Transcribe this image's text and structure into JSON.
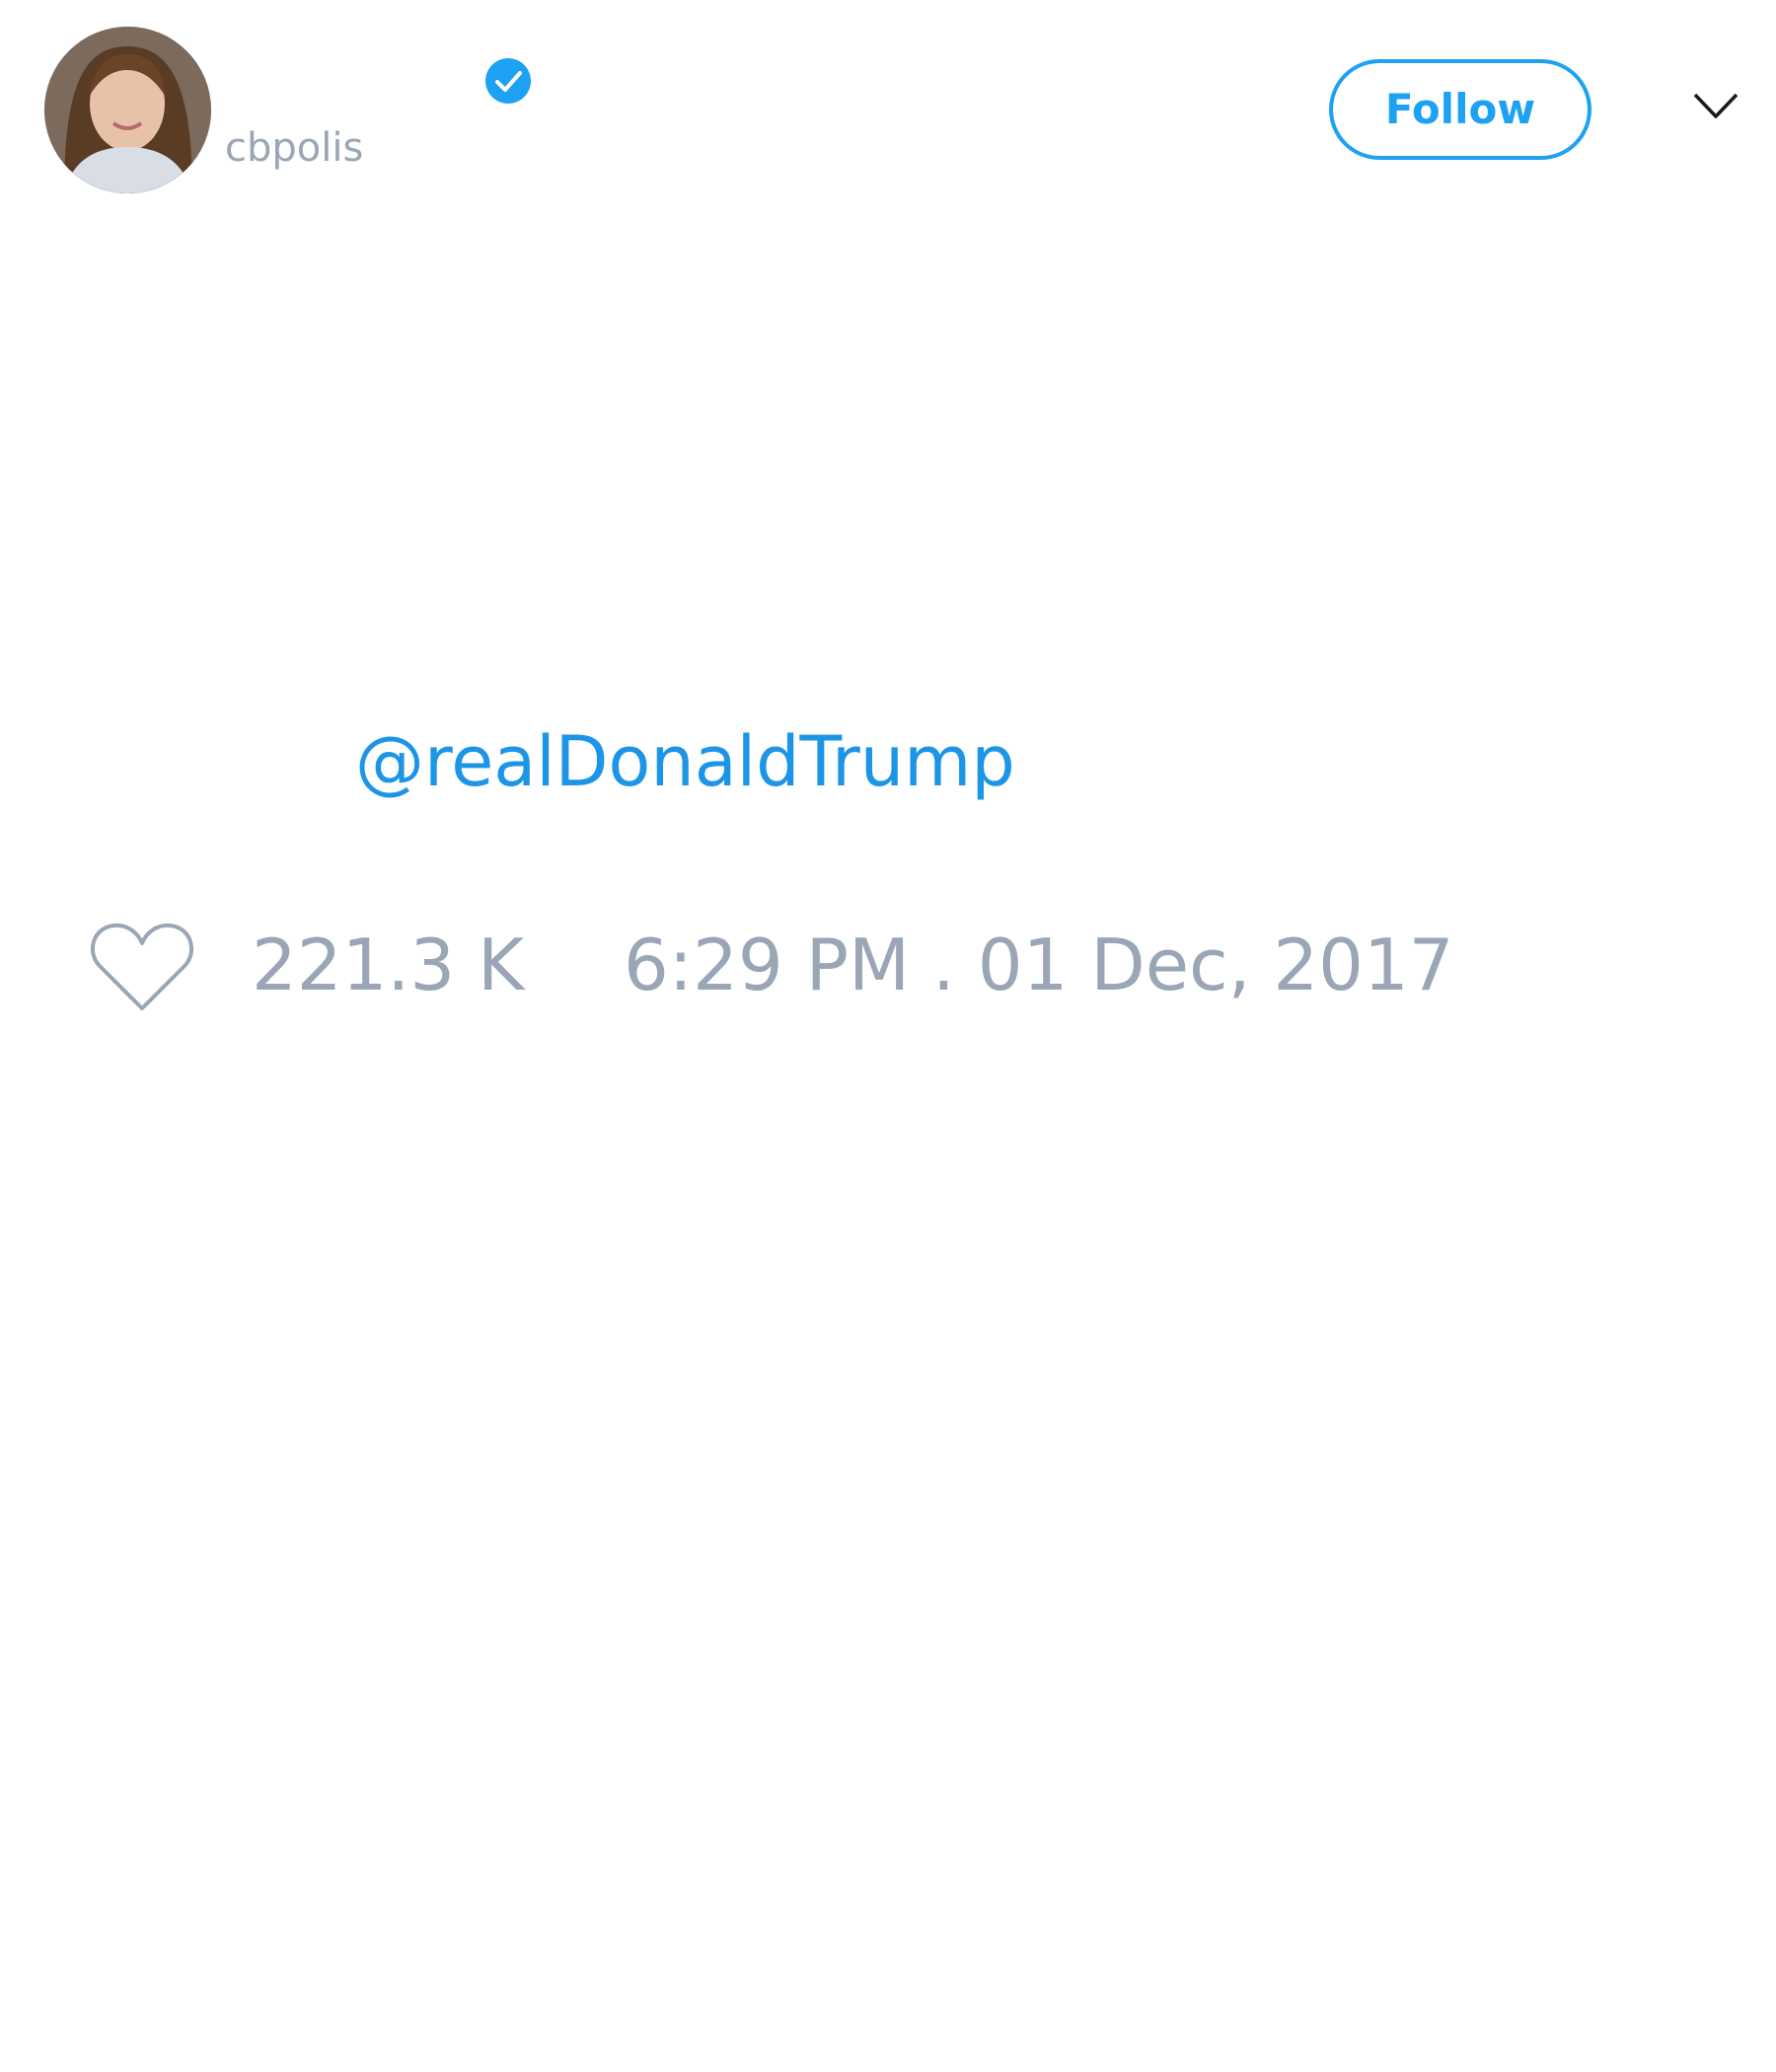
{
  "user": {
    "handle": "cbpolis",
    "verified": true,
    "avatar_icon": "profile-photo"
  },
  "header": {
    "follow_label": "Follow",
    "menu_icon": "chevron-down-icon"
  },
  "tweet": {
    "mention": "@realDonaldTrump"
  },
  "footer": {
    "like_icon": "heart-outline-icon",
    "like_count": "221.3 K",
    "timestamp": "6:29 PM . 01 Dec, 2017"
  },
  "colors": {
    "accent": "#1da1f2",
    "link": "#1d95e6",
    "muted": "#9aa6b6",
    "background": "#ffffff"
  }
}
